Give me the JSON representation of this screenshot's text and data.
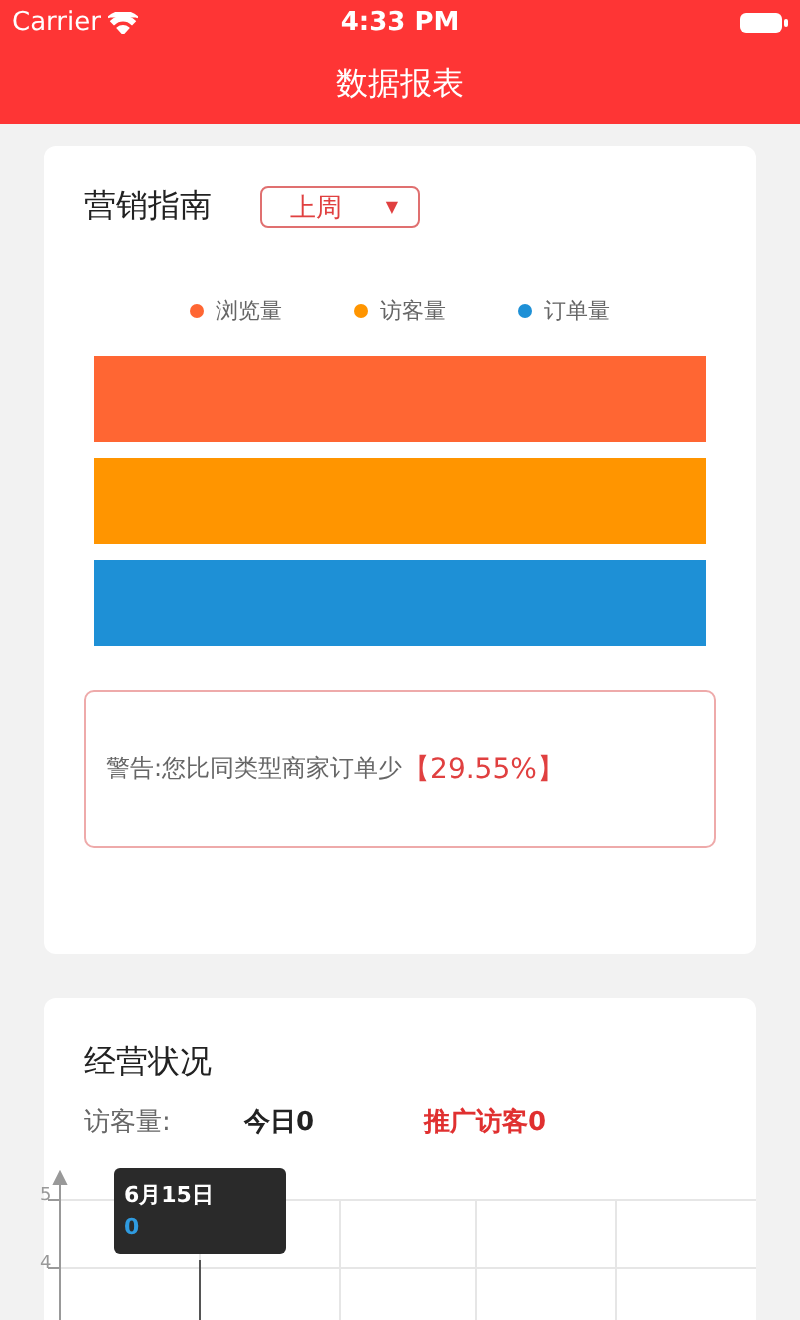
{
  "status_bar": {
    "carrier": "Carrier",
    "time": "4:33 PM"
  },
  "nav": {
    "title": "数据报表"
  },
  "marketing": {
    "title": "营销指南",
    "period": "上周",
    "dropdown_caret": "▼",
    "legend": [
      {
        "label": "浏览量",
        "color": "#ff6633"
      },
      {
        "label": "访客量",
        "color": "#ff9500"
      },
      {
        "label": "订单量",
        "color": "#1e90d6"
      }
    ],
    "warning": {
      "text": "警告:您比同类型商家订单少",
      "value": "【29.55%】"
    }
  },
  "business": {
    "title": "经营状况",
    "visitor_label": "访客量:",
    "today": "今日0",
    "promoted": "推广访客0",
    "y_ticks": [
      "5",
      "4"
    ],
    "tooltip": {
      "date": "6月15日",
      "value": "0"
    }
  }
}
